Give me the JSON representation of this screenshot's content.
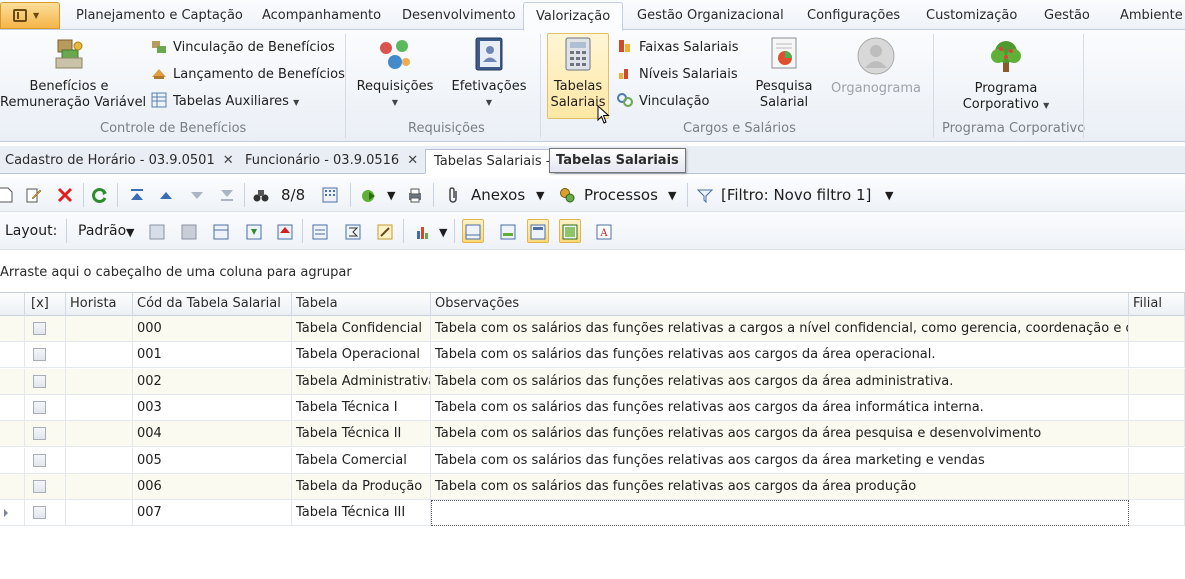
{
  "ribbon_tabs": [
    "Planejamento e Captação",
    "Acompanhamento",
    "Desenvolvimento",
    "Valorização",
    "Gestão Organizacional",
    "Configurações",
    "Customização",
    "Gestão",
    "Ambiente"
  ],
  "active_tab": "Valorização",
  "groups": {
    "controle": {
      "big_button_line1": "Benefícios e",
      "big_button_line2": "Remuneração Variável",
      "items": [
        "Vinculação de Benefícios",
        "Lançamento de Benefícios",
        "Tabelas Auxiliares"
      ],
      "label": "Controle de Benefícios"
    },
    "requisicoes": {
      "requisicoes": "Requisições",
      "efetivacoes": "Efetivações",
      "label": "Requisições"
    },
    "cargos": {
      "tabelas_line1": "Tabelas",
      "tabelas_line2": "Salariais",
      "items": [
        "Faixas Salariais",
        "Níveis Salariais",
        "Vinculação"
      ],
      "pesquisa_line1": "Pesquisa",
      "pesquisa_line2": "Salarial",
      "organograma": "Organograma",
      "label": "Cargos e Salários"
    },
    "programa": {
      "line1": "Programa",
      "line2": "Corporativo",
      "label": "Programa Corporativo"
    }
  },
  "tooltip": "Tabelas Salariais",
  "doc_tabs": [
    "Cadastro de Horário - 03.9.0501",
    "Funcionário - 03.9.0516",
    "Tabelas Salariais - 0"
  ],
  "toolbar": {
    "record_count": "8/8",
    "anexos": "Anexos",
    "processos": "Processos",
    "filter": "[Filtro: Novo filtro 1]",
    "layout_label": "Layout:",
    "layout_value": "Padrão"
  },
  "group_hint": "Arraste aqui o cabeçalho de uma coluna para agrupar",
  "columns": [
    "[x]",
    "Horista",
    "Cód da Tabela Salarial",
    "Tabela",
    "Observações",
    "Filial"
  ],
  "rows": [
    {
      "code": "000",
      "table": "Tabela Confidencial",
      "obs": "Tabela com os salários das funções relativas a cargos a nível confidencial, como gerencia, coordenação e diretoria."
    },
    {
      "code": "001",
      "table": "Tabela Operacional",
      "obs": "Tabela com os salários das funções relativas aos cargos da área operacional."
    },
    {
      "code": "002",
      "table": "Tabela Administrativa",
      "obs": "Tabela com os salários das funções relativas aos cargos da área administrativa."
    },
    {
      "code": "003",
      "table": "Tabela Técnica I",
      "obs": "Tabela com os salários das funções relativas aos cargos da área informática interna."
    },
    {
      "code": "004",
      "table": "Tabela Técnica II",
      "obs": "Tabela com os salários das funções relativas aos cargos da área pesquisa e desenvolvimento"
    },
    {
      "code": "005",
      "table": "Tabela Comercial",
      "obs": "Tabela com os salários das funções relativas aos cargos da área marketing e vendas"
    },
    {
      "code": "006",
      "table": "Tabela da Produção",
      "obs": "Tabela com os salários das funções relativas aos cargos da área produção"
    },
    {
      "code": "007",
      "table": "Tabela Técnica III",
      "obs": ""
    }
  ]
}
